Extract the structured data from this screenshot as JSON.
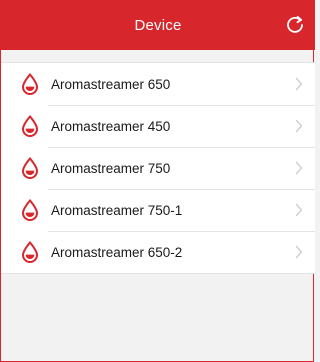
{
  "header": {
    "title": "Device",
    "refresh_icon": "refresh-icon"
  },
  "colors": {
    "brand": "#d7262c",
    "background": "#f2f2f2",
    "list_background": "#ffffff",
    "chevron": "#c7c7cc"
  },
  "devices": {
    "items": [
      {
        "label": "Aromastreamer 650",
        "icon": "drop-icon"
      },
      {
        "label": "Aromastreamer 450",
        "icon": "drop-icon"
      },
      {
        "label": "Aromastreamer 750",
        "icon": "drop-icon"
      },
      {
        "label": "Aromastreamer 750-1",
        "icon": "drop-icon"
      },
      {
        "label": "Aromastreamer 650-2",
        "icon": "drop-icon"
      }
    ]
  }
}
